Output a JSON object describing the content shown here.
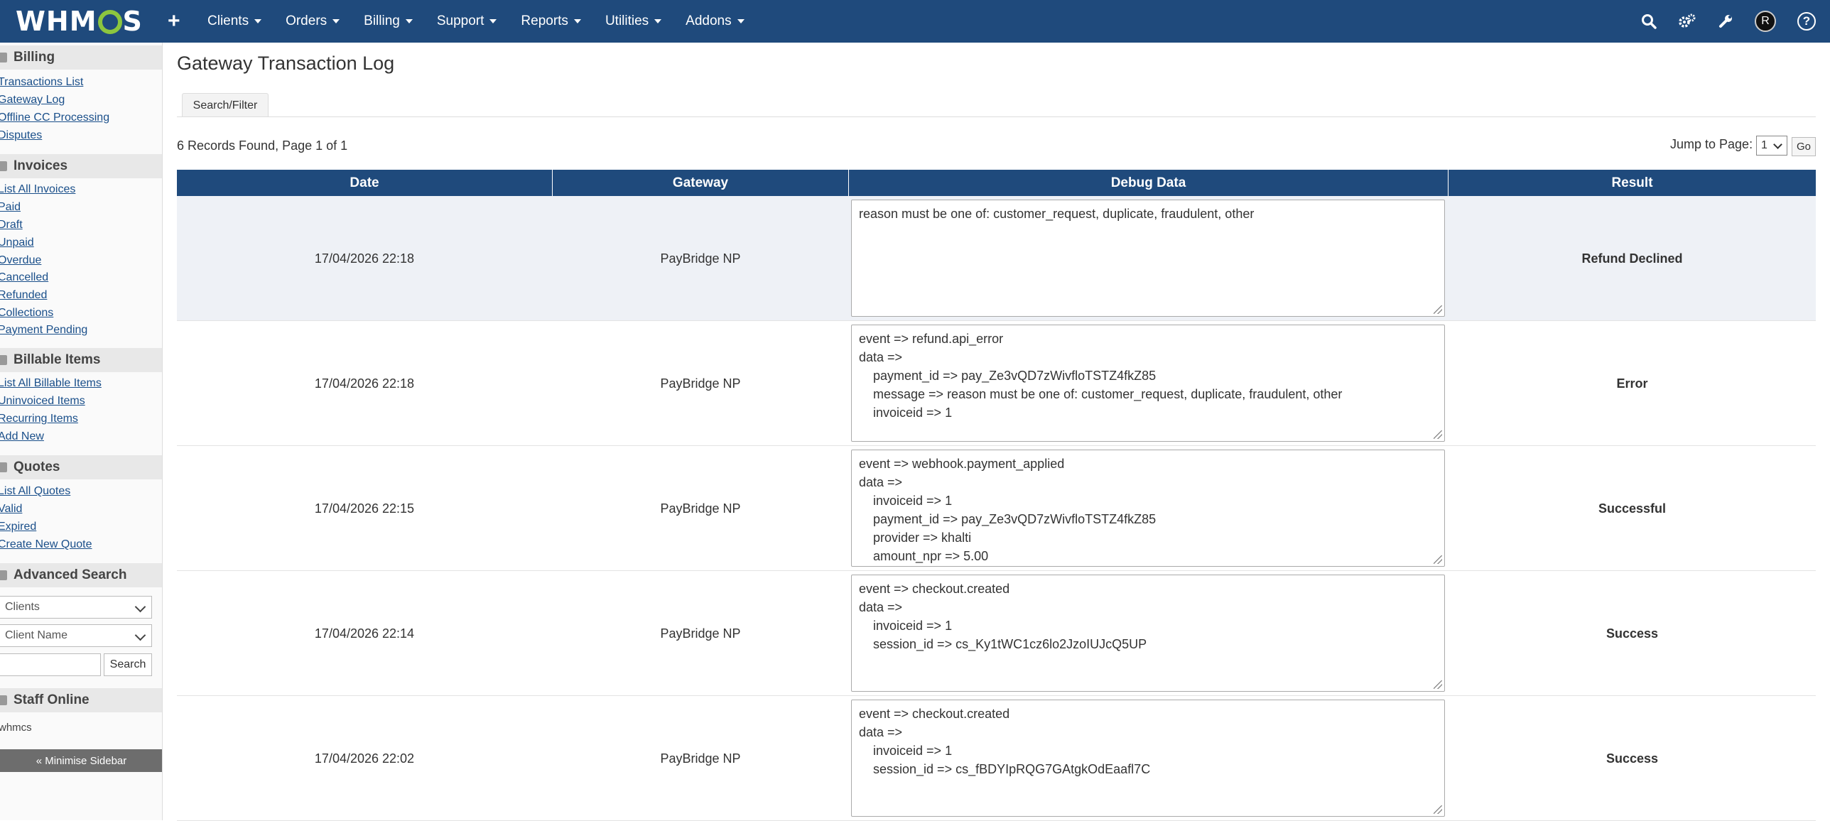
{
  "app": {
    "logo_text": "WHMCS"
  },
  "nav": {
    "menu": [
      "Clients",
      "Orders",
      "Billing",
      "Support",
      "Reports",
      "Utilities",
      "Addons"
    ],
    "avatar_letter": "R",
    "help_label": "?"
  },
  "sidebar": {
    "billing": {
      "title": "Billing",
      "links": [
        "Transactions List",
        "Gateway Log",
        "Offline CC Processing",
        "Disputes"
      ]
    },
    "invoices": {
      "title": "Invoices",
      "links": [
        "List All Invoices",
        "Paid",
        "Draft",
        "Unpaid",
        "Overdue",
        "Cancelled",
        "Refunded",
        "Collections",
        "Payment Pending"
      ]
    },
    "billable": {
      "title": "Billable Items",
      "links": [
        "List All Billable Items",
        "Uninvoiced Items",
        "Recurring Items",
        "Add New"
      ]
    },
    "quotes": {
      "title": "Quotes",
      "links": [
        "List All Quotes",
        "Valid",
        "Expired",
        "Create New Quote"
      ]
    },
    "advanced_search": {
      "title": "Advanced Search",
      "select1": "Clients",
      "select2": "Client Name",
      "button": "Search"
    },
    "staff_online": {
      "title": "Staff Online",
      "staff": "whmcs"
    },
    "minimise": "« Minimise Sidebar"
  },
  "main": {
    "title": "Gateway Transaction Log",
    "tab_search": "Search/Filter",
    "records_text": "6 Records Found, Page 1 of 1",
    "jump_label": "Jump to Page:",
    "jump_value": "1",
    "go_label": "Go",
    "columns": [
      "Date",
      "Gateway",
      "Debug Data",
      "Result"
    ],
    "rows": [
      {
        "date": "17/04/2026 22:18",
        "gateway": "PayBridge NP",
        "debug": "reason must be one of: customer_request, duplicate, fraudulent, other",
        "result": "Refund Declined"
      },
      {
        "date": "17/04/2026 22:18",
        "gateway": "PayBridge NP",
        "debug": "event => refund.api_error\ndata =>\n    payment_id => pay_Ze3vQD7zWivfloTSTZ4fkZ85\n    message => reason must be one of: customer_request, duplicate, fraudulent, other\n    invoiceid => 1",
        "result": "Error"
      },
      {
        "date": "17/04/2026 22:15",
        "gateway": "PayBridge NP",
        "debug": "event => webhook.payment_applied\ndata =>\n    invoiceid => 1\n    payment_id => pay_Ze3vQD7zWivfloTSTZ4fkZ85\n    provider => khalti\n    amount_npr => 5.00",
        "result": "Successful"
      },
      {
        "date": "17/04/2026 22:14",
        "gateway": "PayBridge NP",
        "debug": "event => checkout.created\ndata =>\n    invoiceid => 1\n    session_id => cs_Ky1tWC1cz6lo2JzoIUJcQ5UP",
        "result": "Success"
      },
      {
        "date": "17/04/2026 22:02",
        "gateway": "PayBridge NP",
        "debug": "event => checkout.created\ndata =>\n    invoiceid => 1\n    session_id => cs_fBDYIpRQG7GAtgkOdEaafl7C",
        "result": "Success"
      }
    ]
  }
}
